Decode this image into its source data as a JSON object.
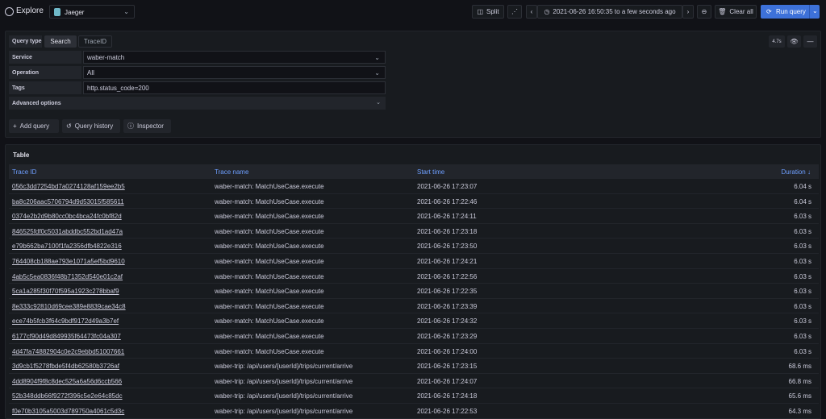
{
  "header": {
    "title": "Explore",
    "datasource": "Jaeger",
    "split_label": "Split",
    "time_range": "2021-06-26 16:50:35 to a few seconds ago",
    "clear_all_label": "Clear all",
    "run_query_label": "Run query"
  },
  "query": {
    "query_type_label": "Query type",
    "tabs": [
      "Search",
      "TraceID"
    ],
    "active_tab": "Search",
    "service_label": "Service",
    "service_value": "waber-match",
    "operation_label": "Operation",
    "operation_value": "All",
    "tags_label": "Tags",
    "tags_value": "http.status_code=200",
    "advanced_label": "Advanced options",
    "query_time": "4.7s",
    "add_query_label": "Add query",
    "query_history_label": "Query history",
    "inspector_label": "Inspector"
  },
  "table": {
    "title": "Table",
    "columns": [
      "Trace ID",
      "Trace name",
      "Start time",
      "Duration"
    ],
    "sorted_column": "Duration",
    "rows": [
      {
        "id": "056c3dd7254bd7a0274128af159ee2b5",
        "name": "waber-match: MatchUseCase.execute",
        "start": "2021-06-26 17:23:07",
        "duration": "6.04 s"
      },
      {
        "id": "ba8c206aac5706794d9d53015f585611",
        "name": "waber-match: MatchUseCase.execute",
        "start": "2021-06-26 17:22:46",
        "duration": "6.04 s"
      },
      {
        "id": "0374e2b2d9b80cc0bc4bca24fc0bf82d",
        "name": "waber-match: MatchUseCase.execute",
        "start": "2021-06-26 17:24:11",
        "duration": "6.03 s"
      },
      {
        "id": "846525fdf0c5031abddbc552bd1ad47a",
        "name": "waber-match: MatchUseCase.execute",
        "start": "2021-06-26 17:23:18",
        "duration": "6.03 s"
      },
      {
        "id": "e79b662ba7100f1fa2356dfb4822e316",
        "name": "waber-match: MatchUseCase.execute",
        "start": "2021-06-26 17:23:50",
        "duration": "6.03 s"
      },
      {
        "id": "764408cb188ae793e1071a5ef5bd9610",
        "name": "waber-match: MatchUseCase.execute",
        "start": "2021-06-26 17:24:21",
        "duration": "6.03 s"
      },
      {
        "id": "4ab5c5ea0836f48b71352d540e01c2af",
        "name": "waber-match: MatchUseCase.execute",
        "start": "2021-06-26 17:22:56",
        "duration": "6.03 s"
      },
      {
        "id": "5ca1a285f30f70f595a1923c278bbaf9",
        "name": "waber-match: MatchUseCase.execute",
        "start": "2021-06-26 17:22:35",
        "duration": "6.03 s"
      },
      {
        "id": "8e333c92810d69cee389e8839cae34c8",
        "name": "waber-match: MatchUseCase.execute",
        "start": "2021-06-26 17:23:39",
        "duration": "6.03 s"
      },
      {
        "id": "ece74b5fcb3f64c9bdf9172d49a3b7ef",
        "name": "waber-match: MatchUseCase.execute",
        "start": "2021-06-26 17:24:32",
        "duration": "6.03 s"
      },
      {
        "id": "6177cf90d49d849935f64473fc04a307",
        "name": "waber-match: MatchUseCase.execute",
        "start": "2021-06-26 17:23:29",
        "duration": "6.03 s"
      },
      {
        "id": "4d47fa74882904c0e2c9ebbd51007661",
        "name": "waber-match: MatchUseCase.execute",
        "start": "2021-06-26 17:24:00",
        "duration": "6.03 s"
      },
      {
        "id": "3d9cb1f5278fbde5f4db62580b3726af",
        "name": "waber-trip: /api/users/{userId}/trips/current/arrive",
        "start": "2021-06-26 17:23:15",
        "duration": "68.6 ms"
      },
      {
        "id": "4dd8904f9f8c8dec525a6a56d6ccb566",
        "name": "waber-trip: /api/users/{userId}/trips/current/arrive",
        "start": "2021-06-26 17:24:07",
        "duration": "66.8 ms"
      },
      {
        "id": "52b348ddb66f9272f396c5e2e64c85dc",
        "name": "waber-trip: /api/users/{userId}/trips/current/arrive",
        "start": "2021-06-26 17:24:18",
        "duration": "65.6 ms"
      },
      {
        "id": "f0e70b3105a5003d789750a4061c5d3c",
        "name": "waber-trip: /api/users/{userId}/trips/current/arrive",
        "start": "2021-06-26 17:22:53",
        "duration": "64.3 ms"
      }
    ]
  },
  "colors": {
    "background": "#111217",
    "panel": "#181b1f",
    "accent": "#3d71d9",
    "link": "#6e9fff"
  }
}
